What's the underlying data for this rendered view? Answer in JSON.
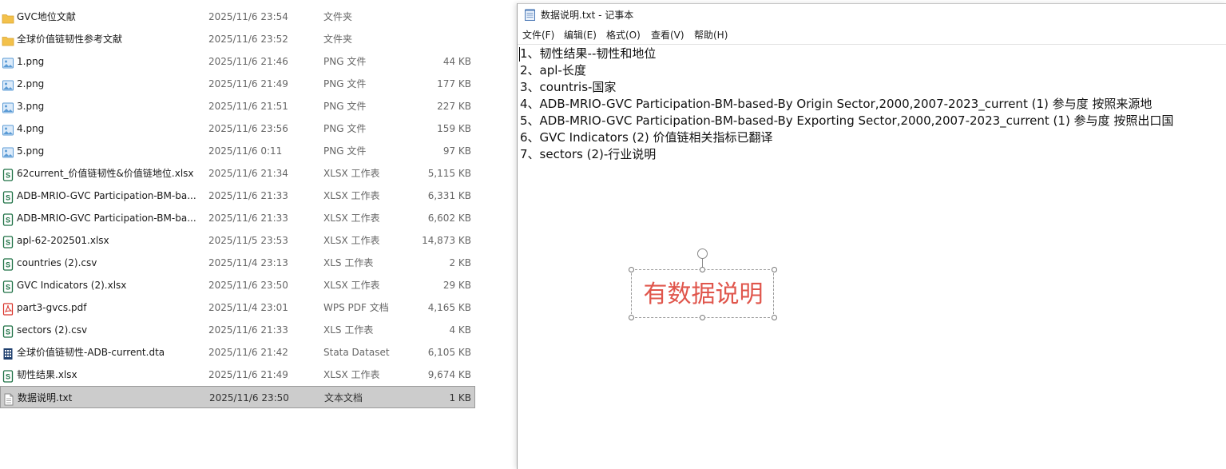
{
  "explorer": {
    "files": [
      {
        "name": "GVC地位文献",
        "date": "2025/11/6 23:54",
        "type": "文件夹",
        "size": "",
        "icon": "folder-icon"
      },
      {
        "name": "全球价值链韧性参考文献",
        "date": "2025/11/6 23:52",
        "type": "文件夹",
        "size": "",
        "icon": "folder-icon"
      },
      {
        "name": "1.png",
        "date": "2025/11/6 21:46",
        "type": "PNG 文件",
        "size": "44 KB",
        "icon": "image-icon"
      },
      {
        "name": "2.png",
        "date": "2025/11/6 21:49",
        "type": "PNG 文件",
        "size": "177 KB",
        "icon": "image-icon"
      },
      {
        "name": "3.png",
        "date": "2025/11/6 21:51",
        "type": "PNG 文件",
        "size": "227 KB",
        "icon": "image-icon"
      },
      {
        "name": "4.png",
        "date": "2025/11/6 23:56",
        "type": "PNG 文件",
        "size": "159 KB",
        "icon": "image-icon"
      },
      {
        "name": "5.png",
        "date": "2025/11/6 0:11",
        "type": "PNG 文件",
        "size": "97 KB",
        "icon": "image-icon"
      },
      {
        "name": "62current_价值链韧性&价值链地位.xlsx",
        "date": "2025/11/6 21:34",
        "type": "XLSX 工作表",
        "size": "5,115 KB",
        "icon": "spreadsheet-icon"
      },
      {
        "name": "ADB-MRIO-GVC Participation-BM-ba...",
        "date": "2025/11/6 21:33",
        "type": "XLSX 工作表",
        "size": "6,331 KB",
        "icon": "spreadsheet-icon"
      },
      {
        "name": "ADB-MRIO-GVC Participation-BM-ba...",
        "date": "2025/11/6 21:33",
        "type": "XLSX 工作表",
        "size": "6,602 KB",
        "icon": "spreadsheet-icon"
      },
      {
        "name": "apl-62-202501.xlsx",
        "date": "2025/11/5 23:53",
        "type": "XLSX 工作表",
        "size": "14,873 KB",
        "icon": "spreadsheet-icon"
      },
      {
        "name": "countries (2).csv",
        "date": "2025/11/4 23:13",
        "type": "XLS 工作表",
        "size": "2 KB",
        "icon": "spreadsheet-icon"
      },
      {
        "name": "GVC Indicators (2).xlsx",
        "date": "2025/11/6 23:50",
        "type": "XLSX 工作表",
        "size": "29 KB",
        "icon": "spreadsheet-icon"
      },
      {
        "name": "part3-gvcs.pdf",
        "date": "2025/11/4 23:01",
        "type": "WPS PDF 文档",
        "size": "4,165 KB",
        "icon": "pdf-icon"
      },
      {
        "name": "sectors (2).csv",
        "date": "2025/11/6 21:33",
        "type": "XLS 工作表",
        "size": "4 KB",
        "icon": "spreadsheet-icon"
      },
      {
        "name": "全球价值链韧性-ADB-current.dta",
        "date": "2025/11/6 21:42",
        "type": "Stata Dataset",
        "size": "6,105 KB",
        "icon": "stata-dataset-icon"
      },
      {
        "name": "韧性结果.xlsx",
        "date": "2025/11/6 21:49",
        "type": "XLSX 工作表",
        "size": "9,674 KB",
        "icon": "spreadsheet-icon"
      },
      {
        "name": "数据说明.txt",
        "date": "2025/11/6 23:50",
        "type": "文本文档",
        "size": "1 KB",
        "icon": "text-file-icon",
        "selected": true
      }
    ]
  },
  "notepad": {
    "title": "数据说明.txt - 记事本",
    "menu": [
      "文件(F)",
      "编辑(E)",
      "格式(O)",
      "查看(V)",
      "帮助(H)"
    ],
    "lines": [
      "1、韧性结果--韧性和地位",
      "2、apl-长度",
      "3、countris-国家",
      "4、ADB-MRIO-GVC Participation-BM-based-By Origin Sector,2000,2007-2023_current (1) 参与度 按照来源地",
      "5、ADB-MRIO-GVC Participation-BM-based-By Exporting Sector,2000,2007-2023_current (1) 参与度 按照出口国",
      "6、GVC Indicators (2) 价值链相关指标已翻译",
      "7、sectors (2)-行业说明"
    ]
  },
  "annotation": {
    "text": "有数据说明",
    "color": "#e0564c"
  },
  "colors": {
    "folder": "#f3c14b",
    "image": "#5b9bd5",
    "spreadsheet": "#1e7145",
    "pdf": "#d9342b",
    "stata": "#1f3f6e",
    "selection": "#cccccc"
  }
}
